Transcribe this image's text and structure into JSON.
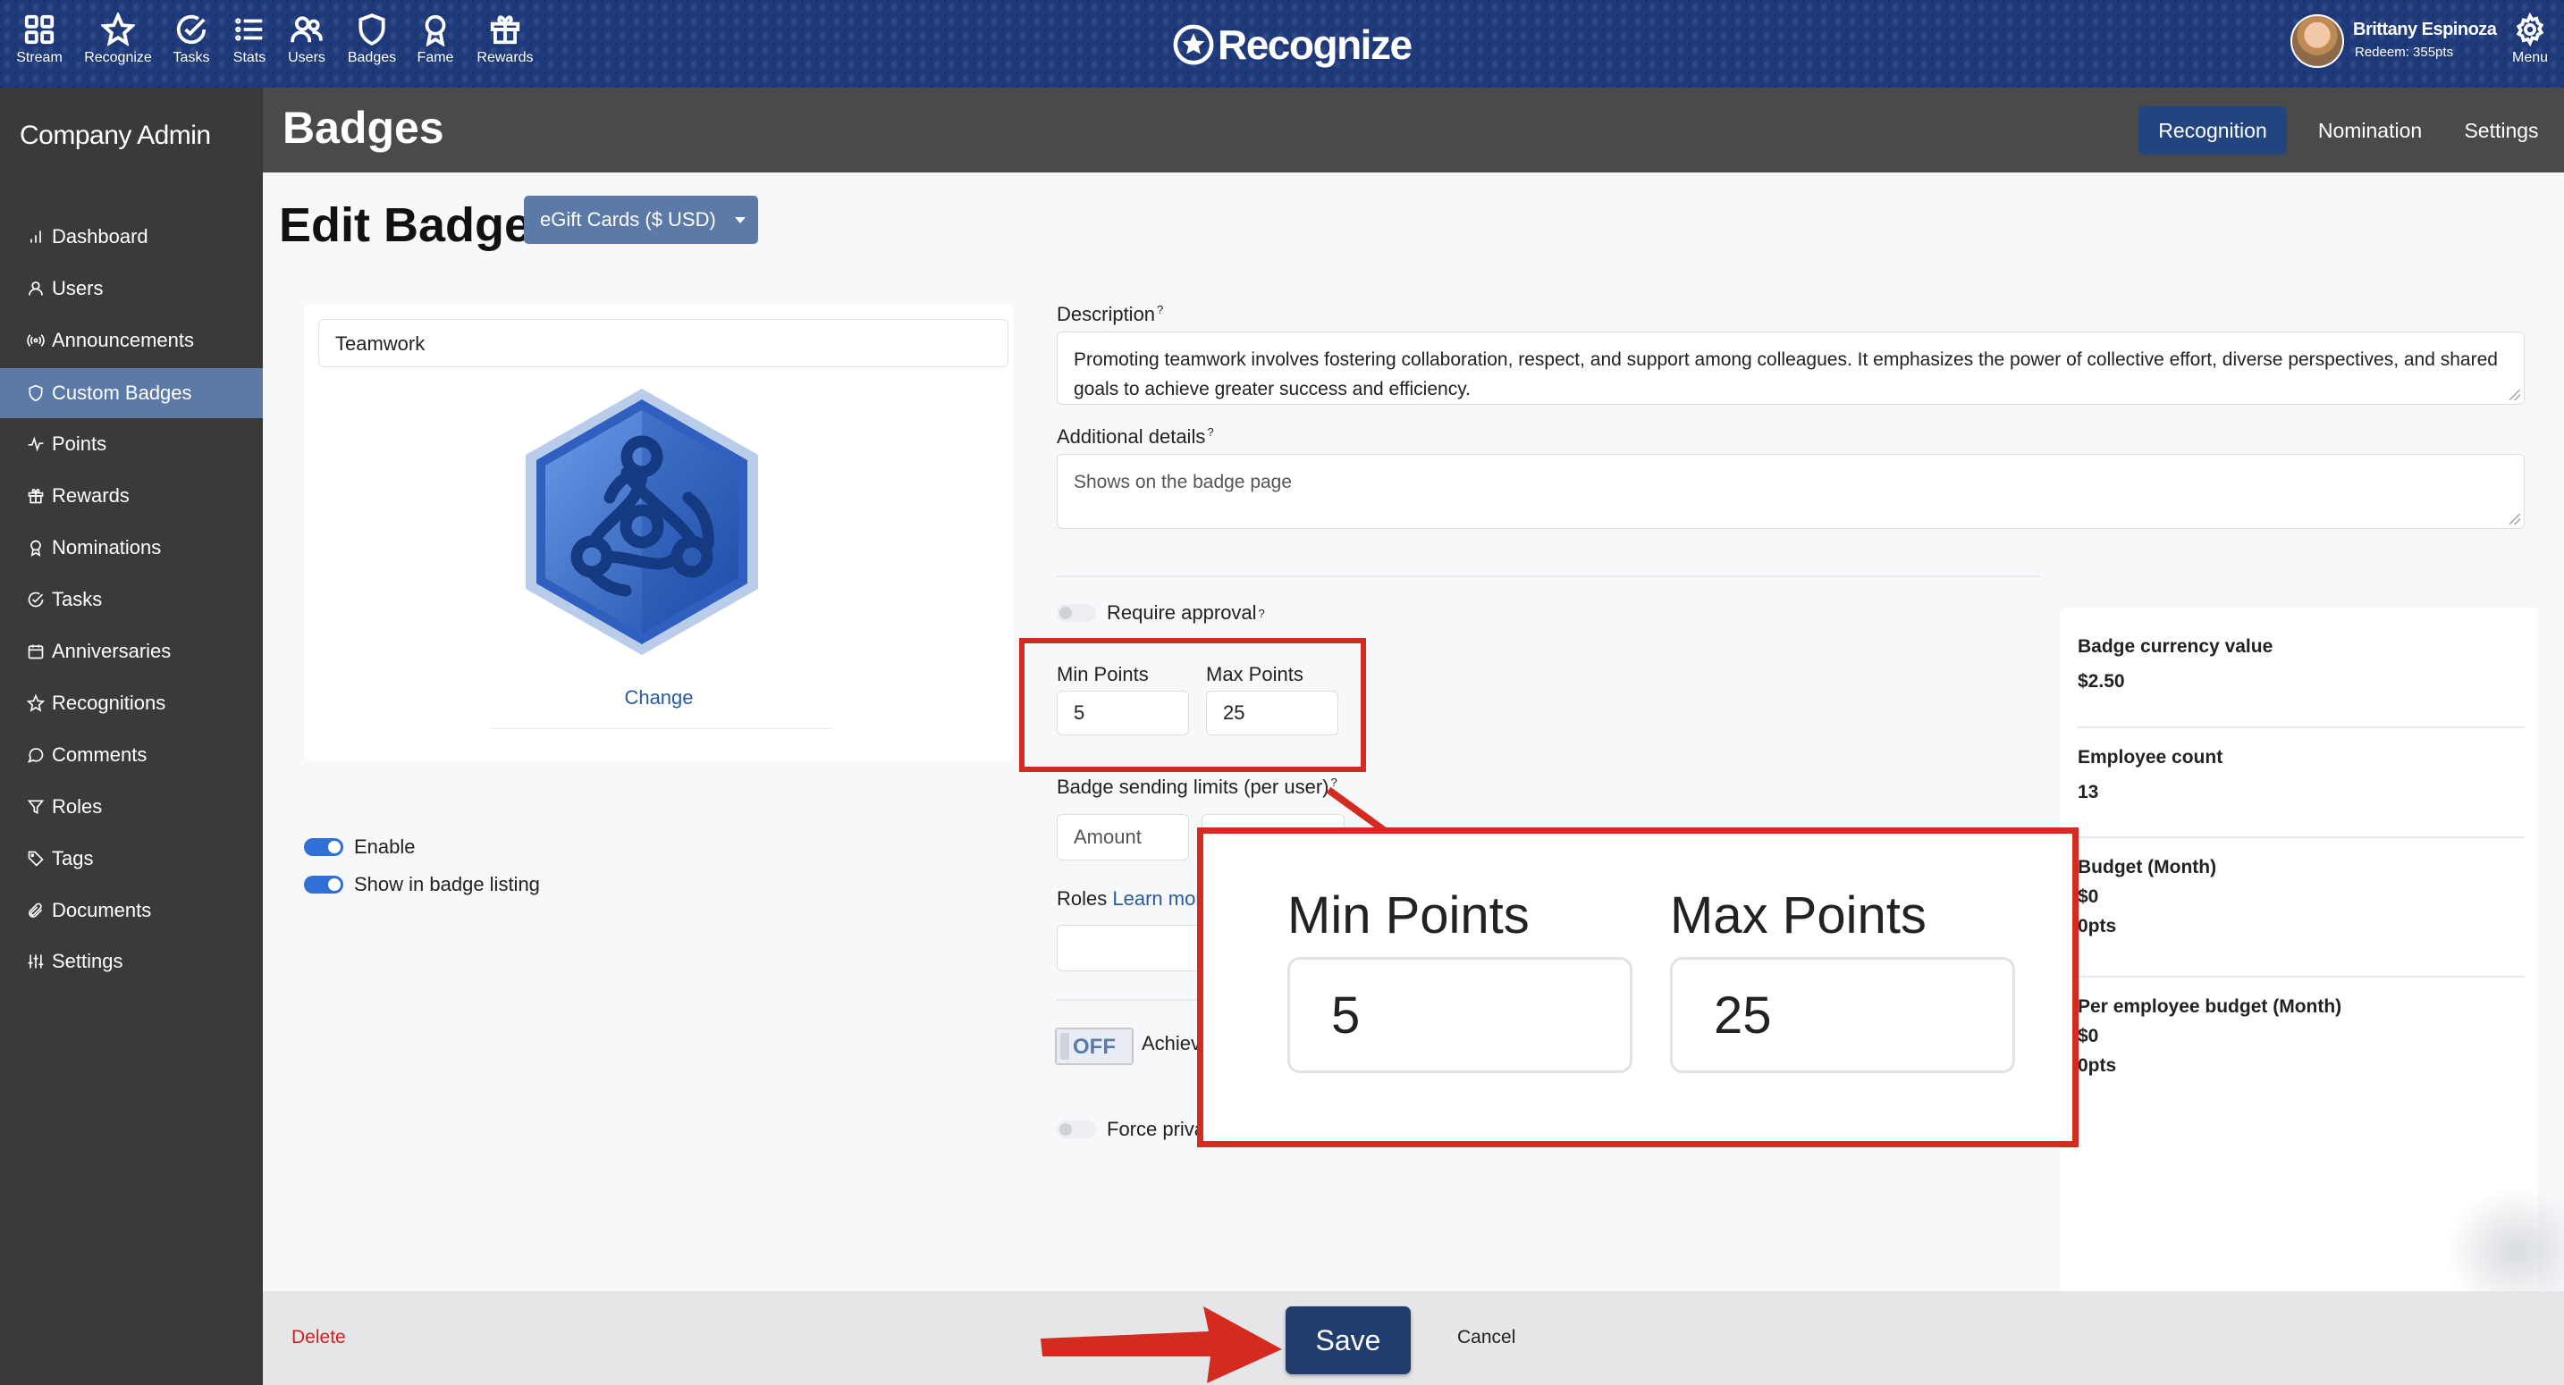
{
  "topnav": {
    "items": [
      {
        "label": "Stream",
        "icon": "grid-icon"
      },
      {
        "label": "Recognize",
        "icon": "star-icon"
      },
      {
        "label": "Tasks",
        "icon": "check-circle-icon"
      },
      {
        "label": "Stats",
        "icon": "list-icon"
      },
      {
        "label": "Users",
        "icon": "users-icon"
      },
      {
        "label": "Badges",
        "icon": "shield-icon"
      },
      {
        "label": "Fame",
        "icon": "award-icon"
      },
      {
        "label": "Rewards",
        "icon": "gift-icon"
      }
    ],
    "logo_text": "Recognize",
    "user_name": "Brittany Espinoza",
    "user_redeem": "Redeem: 355pts",
    "menu_label": "Menu"
  },
  "sidebar": {
    "title": "Company Admin",
    "items": [
      {
        "label": "Dashboard",
        "icon": "bar-chart-icon"
      },
      {
        "label": "Users",
        "icon": "user-icon"
      },
      {
        "label": "Announcements",
        "icon": "broadcast-icon"
      },
      {
        "label": "Custom Badges",
        "icon": "shield-icon",
        "active": true
      },
      {
        "label": "Points",
        "icon": "activity-icon"
      },
      {
        "label": "Rewards",
        "icon": "gift-icon"
      },
      {
        "label": "Nominations",
        "icon": "award-icon"
      },
      {
        "label": "Tasks",
        "icon": "check-circle-icon"
      },
      {
        "label": "Anniversaries",
        "icon": "calendar-icon"
      },
      {
        "label": "Recognitions",
        "icon": "star-icon"
      },
      {
        "label": "Comments",
        "icon": "comment-icon"
      },
      {
        "label": "Roles",
        "icon": "filter-icon"
      },
      {
        "label": "Tags",
        "icon": "tag-icon"
      },
      {
        "label": "Documents",
        "icon": "paperclip-icon"
      },
      {
        "label": "Settings",
        "icon": "sliders-icon"
      }
    ]
  },
  "header": {
    "title": "Badges",
    "tabs": [
      {
        "label": "Recognition",
        "active": true
      },
      {
        "label": "Nomination"
      },
      {
        "label": "Settings"
      }
    ]
  },
  "edit": {
    "title": "Edit Badge",
    "currency": "eGift Cards ($ USD)",
    "badge_name": "Teamwork",
    "change_label": "Change",
    "enable_label": "Enable",
    "show_listing_label": "Show in badge listing",
    "description_label": "Description",
    "description_value": "Promoting teamwork involves fostering collaboration, respect, and support among colleagues. It emphasizes the power of collective effort, diverse perspectives, and shared goals to achieve greater success and efficiency.",
    "additional_label": "Additional details",
    "additional_placeholder": "Shows on the badge page",
    "question_mark": "?",
    "require_approval_label": "Require approval",
    "min_points_label": "Min Points",
    "max_points_label": "Max Points",
    "min_points": "5",
    "max_points": "25",
    "sending_limits_label": "Badge sending limits (per user)",
    "amount_placeholder": "Amount",
    "roles_label": "Roles",
    "learn_more": "Learn more",
    "off_label": "OFF",
    "achievement_label": "Achievement",
    "force_private_label": "Force private"
  },
  "stats": {
    "currency_value_label": "Badge currency value",
    "currency_value": "$2.50",
    "employee_count_label": "Employee count",
    "employee_count": "13",
    "budget_label": "Budget (Month)",
    "budget_money": "$0",
    "budget_pts": "0pts",
    "per_employee_label": "Per employee budget (Month)",
    "per_employee_money": "$0",
    "per_employee_pts": "0pts"
  },
  "footer": {
    "delete_label": "Delete",
    "save_label": "Save",
    "cancel_label": "Cancel"
  },
  "colors": {
    "highlight": "#d42a1f",
    "primary": "#1f3e6e",
    "active_tab": "#22457f",
    "sidebar_active": "#5c7aa8"
  }
}
